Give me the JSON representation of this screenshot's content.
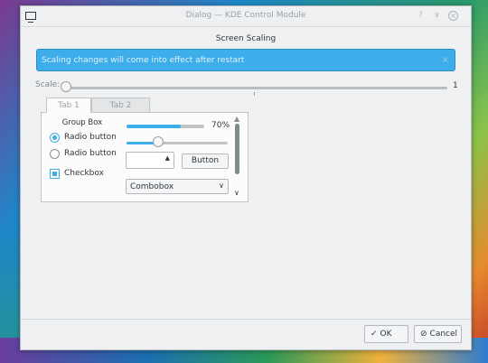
{
  "window": {
    "title": "Dialog — KDE Control Module",
    "heading": "Screen Scaling",
    "titlebar_buttons": [
      "?",
      "∨",
      "×"
    ]
  },
  "info_bar": {
    "message": "Scaling changes will come into effect after restart",
    "close": "×"
  },
  "scale": {
    "label": "Scale:",
    "value_text": "1"
  },
  "tabs": [
    {
      "label": "Tab 1",
      "active": true
    },
    {
      "label": "Tab 2",
      "active": false
    }
  ],
  "groupbox": {
    "title": "Group Box",
    "radios": [
      {
        "label": "Radio button",
        "checked": true
      },
      {
        "label": "Radio button",
        "checked": false
      }
    ],
    "checkbox": {
      "label": "Checkbox",
      "checked": true
    }
  },
  "progress": {
    "text": "70%",
    "fraction": 0.7
  },
  "slider": {
    "fraction": 0.31
  },
  "spinbox": {
    "value": "",
    "arrow": "▲"
  },
  "button_label": "Button",
  "combobox": {
    "value": "Combobox",
    "arrow": "∨"
  },
  "scroll": {
    "up": "▲",
    "down": "∨"
  },
  "dialog_buttons": {
    "ok": {
      "icon": "✓",
      "label": "OK"
    },
    "cancel": {
      "icon": "⊘",
      "label": "Cancel"
    }
  },
  "colors": {
    "accent": "#3daee9",
    "window_bg": "#eff0f1",
    "text": "#31363b"
  }
}
